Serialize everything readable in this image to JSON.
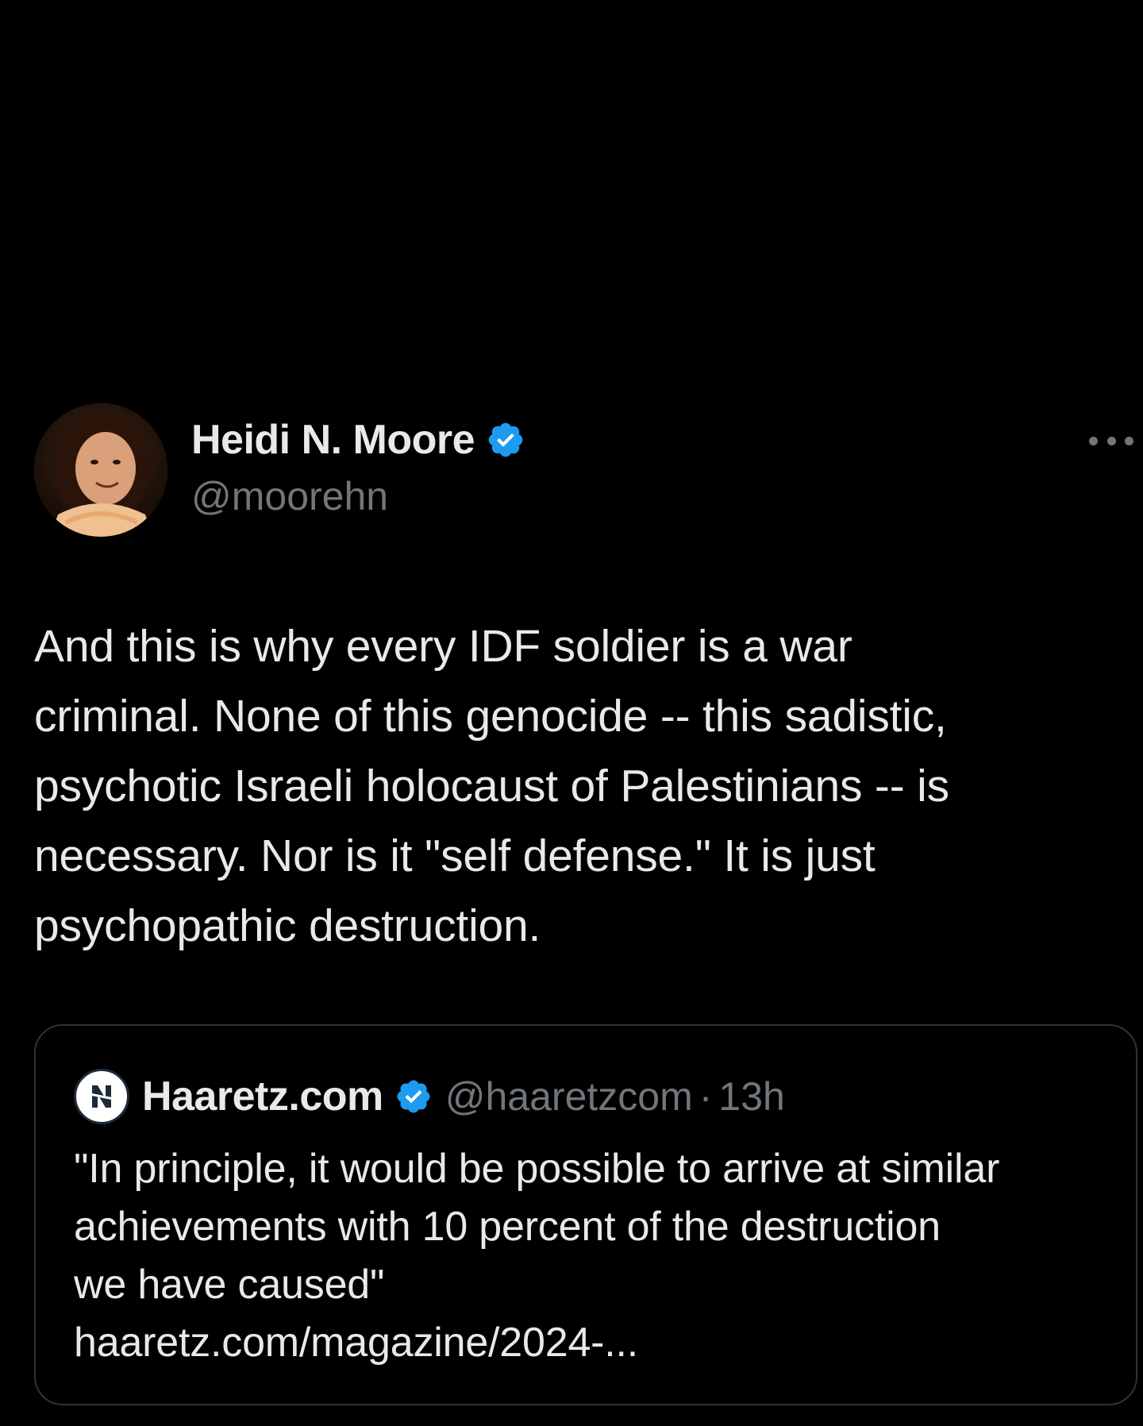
{
  "author": {
    "name": "Heidi N. Moore",
    "handle": "@moorehn",
    "verified": true,
    "avatar_icon": "avatar-photo"
  },
  "more_menu": {
    "icon": "more-horizontal-icon"
  },
  "tweet": {
    "text": "And this is why every IDF soldier is a war\ncriminal. None of this genocide -- this sadistic,\npsychotic Israeli holocaust of Palestinians -- is\nnecessary. Nor is it \"self defense.\" It is just\npsychopathic destruction."
  },
  "quoted_tweet": {
    "name": "Haaretz.com",
    "handle": "@haaretzcom",
    "separator": "·",
    "time": "13h",
    "verified": true,
    "logo_icon": "haaretz-logo",
    "text": "\"In principle, it would be possible to arrive at similar\nachievements with 10 percent of the destruction\nwe have caused\"\nhaaretz.com/magazine/2024-..."
  },
  "colors": {
    "background": "#000000",
    "primary_text": "#e7e9ea",
    "secondary_text": "#71767b",
    "verified_blue": "#1d9bf0",
    "border": "#2f3336"
  }
}
